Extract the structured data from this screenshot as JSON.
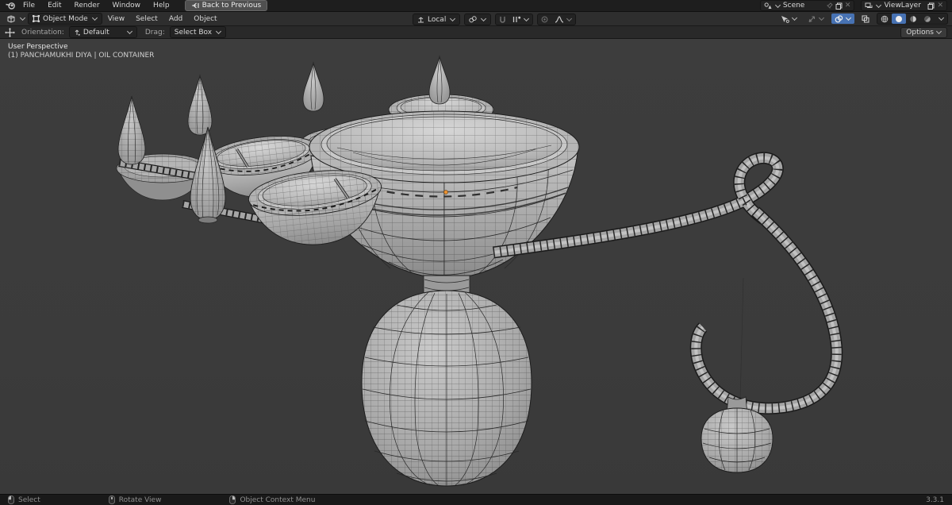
{
  "topbar": {
    "menus": [
      "File",
      "Edit",
      "Render",
      "Window",
      "Help"
    ],
    "back_button": "Back to Previous",
    "scene": {
      "value": "Scene"
    },
    "view_layer": {
      "value": "ViewLayer"
    }
  },
  "header": {
    "mode": "Object Mode",
    "menus": [
      "View",
      "Select",
      "Add",
      "Object"
    ],
    "orientation": "Local"
  },
  "tool_settings": {
    "orientation_label": "Orientation:",
    "orientation_value": "Default",
    "drag_label": "Drag:",
    "drag_value": "Select Box",
    "options_label": "Options"
  },
  "viewport": {
    "perspective_label": "User Perspective",
    "object_label": "(1) PANCHAMUKHI DIYA | OIL CONTAINER"
  },
  "status_bar": {
    "hints": [
      {
        "label": "Select"
      },
      {
        "label": "Rotate View"
      },
      {
        "label": "Object Context Menu"
      }
    ],
    "version": "3.3.1"
  },
  "icons": {
    "close": "✕"
  },
  "colors": {
    "accent_blue": "#4772b3",
    "origin_orange": "#ed9332",
    "viewport_bg": "#3c3c3c",
    "model_gray": "#a8a8a8",
    "wire_dark": "#262626"
  }
}
